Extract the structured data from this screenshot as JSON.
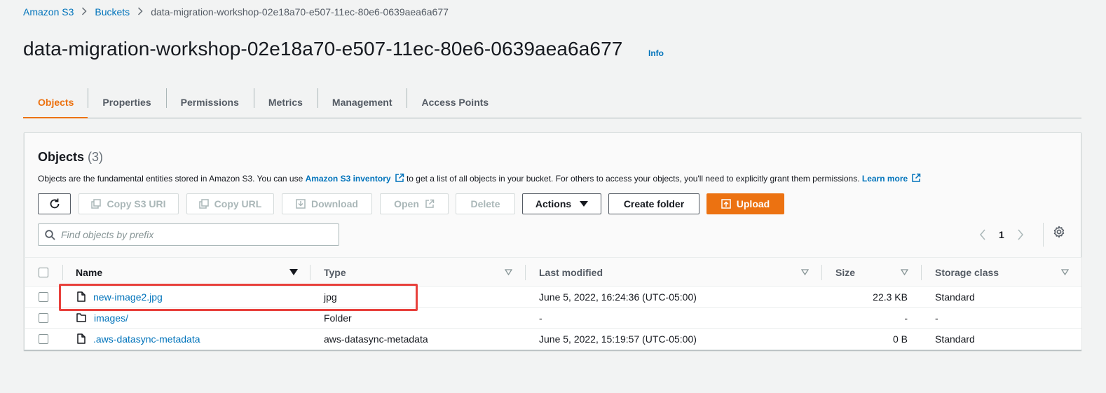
{
  "breadcrumb": {
    "items": [
      "Amazon S3",
      "Buckets"
    ],
    "current": "data-migration-workshop-02e18a70-e507-11ec-80e6-0639aea6a677"
  },
  "page": {
    "title": "data-migration-workshop-02e18a70-e507-11ec-80e6-0639aea6a677",
    "info": "Info"
  },
  "tabs": [
    {
      "label": "Objects",
      "active": true
    },
    {
      "label": "Properties"
    },
    {
      "label": "Permissions"
    },
    {
      "label": "Metrics"
    },
    {
      "label": "Management"
    },
    {
      "label": "Access Points"
    }
  ],
  "objects": {
    "heading": "Objects",
    "count": "(3)",
    "desc_pre": "Objects are the fundamental entities stored in Amazon S3. You can use ",
    "desc_link": "Amazon S3 inventory",
    "desc_mid": " to get a list of all objects in your bucket. For others to access your objects, you'll need to explicitly grant them permissions. ",
    "learn_more": "Learn more"
  },
  "toolbar": {
    "copy_s3_uri": "Copy S3 URI",
    "copy_url": "Copy URL",
    "download": "Download",
    "open": "Open",
    "delete": "Delete",
    "actions": "Actions",
    "create_folder": "Create folder",
    "upload": "Upload"
  },
  "search": {
    "placeholder": "Find objects by prefix",
    "value": ""
  },
  "pagination": {
    "page": "1"
  },
  "table": {
    "columns": [
      "Name",
      "Type",
      "Last modified",
      "Size",
      "Storage class"
    ],
    "rows": [
      {
        "name": "new-image2.jpg",
        "kind": "file",
        "type": "jpg",
        "modified": "June 5, 2022, 16:24:36 (UTC-05:00)",
        "size": "22.3 KB",
        "storage": "Standard"
      },
      {
        "name": "images/",
        "kind": "folder",
        "type": "Folder",
        "modified": "-",
        "size": "-",
        "storage": "-"
      },
      {
        "name": ".aws-datasync-metadata",
        "kind": "file",
        "type": "aws-datasync-metadata",
        "modified": "June 5, 2022, 15:19:57 (UTC-05:00)",
        "size": "0 B",
        "storage": "Standard"
      }
    ]
  },
  "colors": {
    "accent": "#ec7211",
    "link": "#0073bb",
    "highlight": "#e8413c"
  }
}
